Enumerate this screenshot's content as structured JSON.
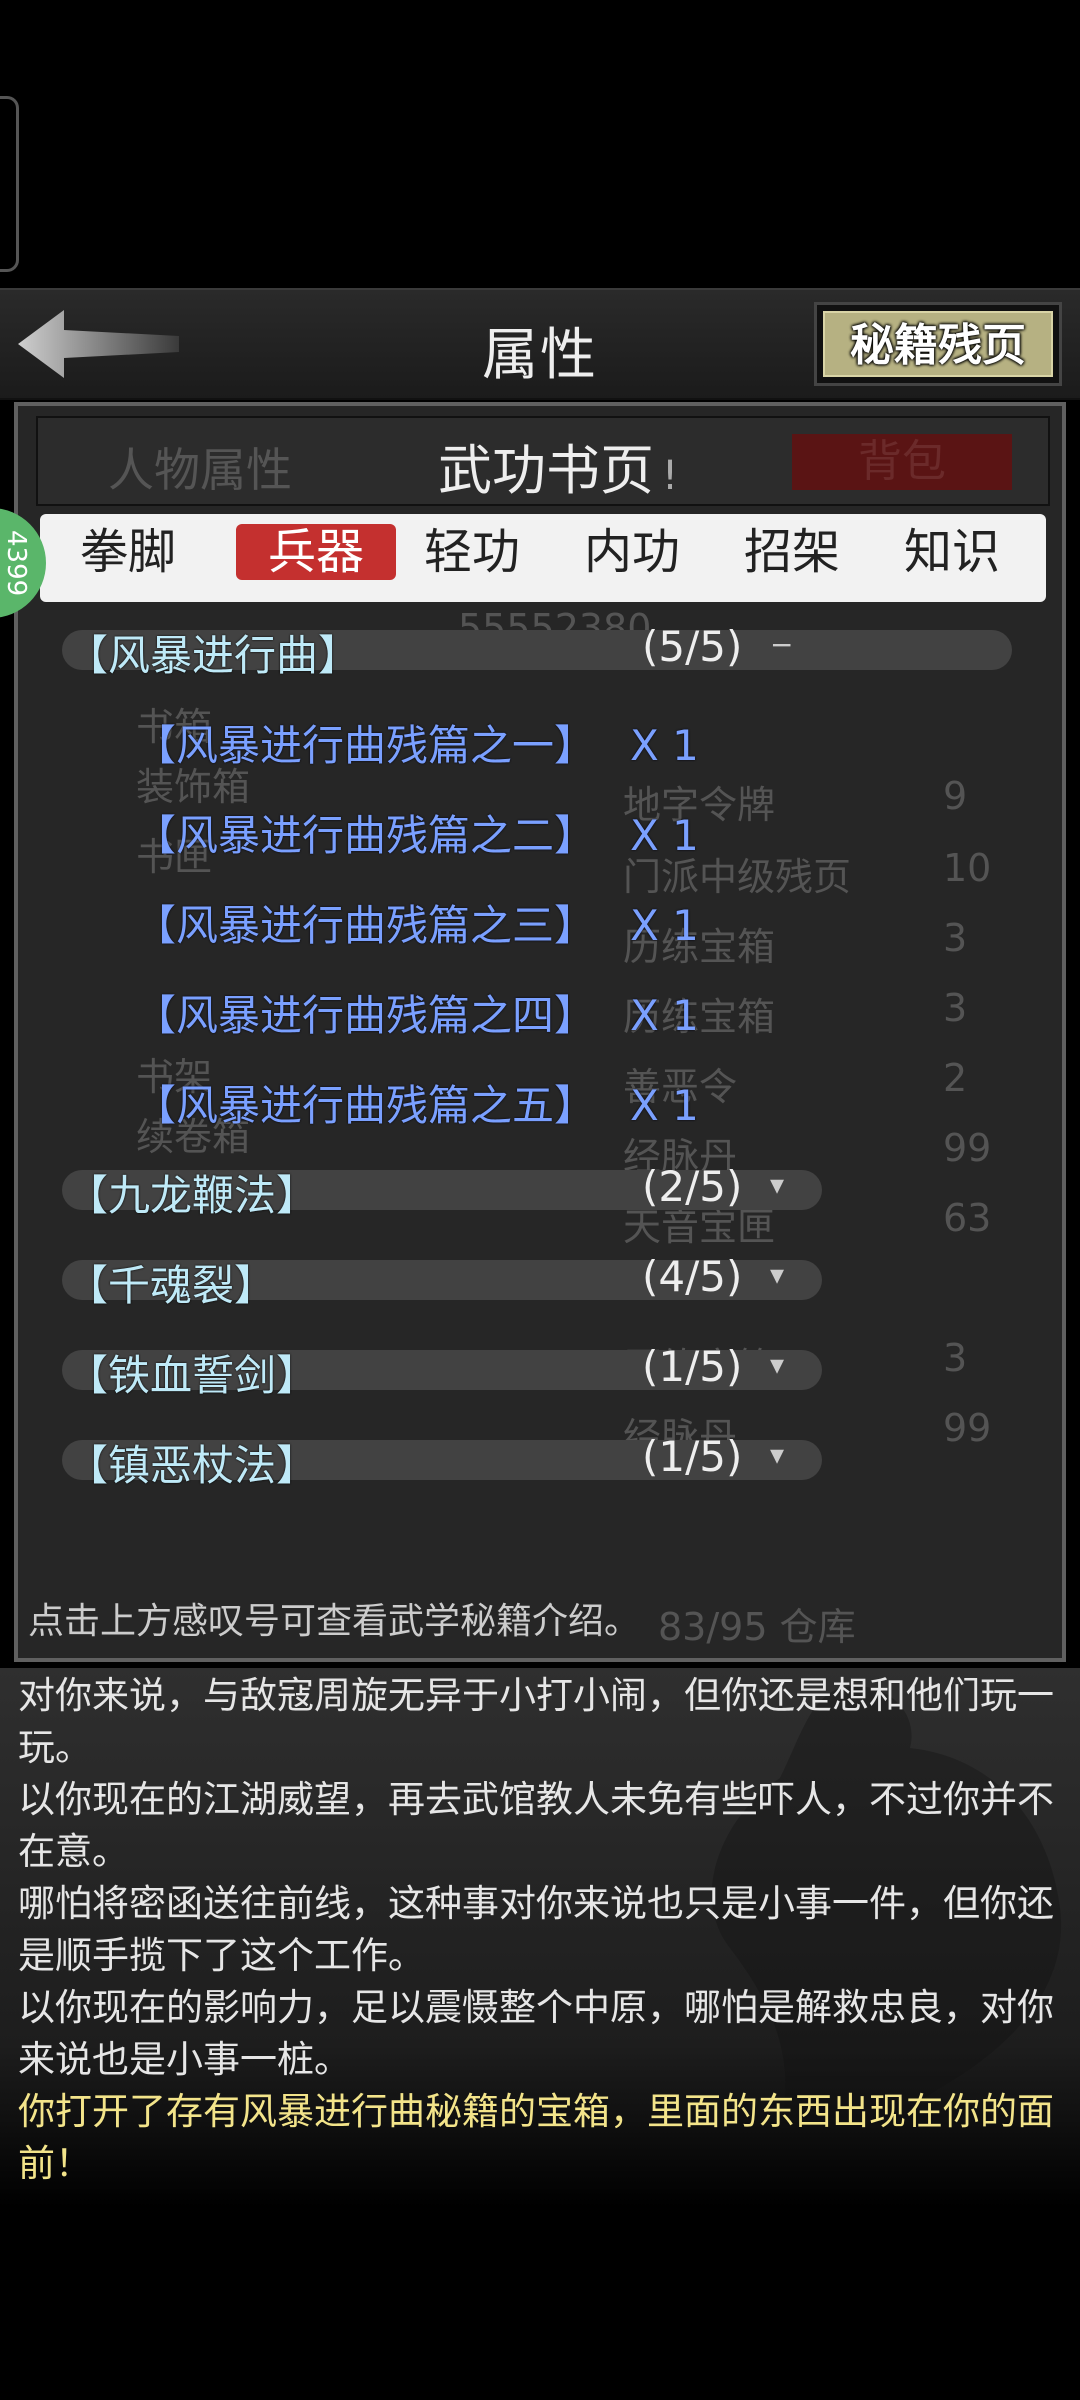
{
  "header": {
    "title": "属性",
    "right_button": "秘籍残页"
  },
  "panel": {
    "sub_title": "武功书页",
    "info_mark": "!",
    "bg_left_tab": "人物属性",
    "bg_right_tab": "背包",
    "side_badge": "4399"
  },
  "categories": [
    {
      "label": "拳脚",
      "active": false
    },
    {
      "label": "兵器",
      "active": true
    },
    {
      "label": "轻功",
      "active": false
    },
    {
      "label": "内功",
      "active": false
    },
    {
      "label": "招架",
      "active": false
    },
    {
      "label": "知识",
      "active": false
    }
  ],
  "books": [
    {
      "name": "【风暴进行曲】",
      "count": "(5/5)",
      "toggle": "−",
      "expanded": true
    },
    {
      "name": "【九龙鞭法】",
      "count": "(2/5)",
      "toggle": "▾",
      "expanded": false
    },
    {
      "name": "【千魂裂】",
      "count": "(4/5)",
      "toggle": "▾",
      "expanded": false
    },
    {
      "name": "【铁血誓剑】",
      "count": "(1/5)",
      "toggle": "▾",
      "expanded": false
    },
    {
      "name": "【镇恶杖法】",
      "count": "(1/5)",
      "toggle": "▾",
      "expanded": false
    }
  ],
  "chapters": [
    {
      "name": "【风暴进行曲残篇之一】",
      "qty": "X 1"
    },
    {
      "name": "【风暴进行曲残篇之二】",
      "qty": "X 1"
    },
    {
      "name": "【风暴进行曲残篇之三】",
      "qty": "X 1"
    },
    {
      "name": "【风暴进行曲残篇之四】",
      "qty": "X 1"
    },
    {
      "name": "【风暴进行曲残篇之五】",
      "qty": "X 1"
    }
  ],
  "background_items": {
    "left": [
      "书箱",
      "装饰箱",
      "书匣",
      "书架",
      "续卷箱"
    ],
    "right_names": [
      "地字令牌",
      "门派中级残页",
      "历练宝箱",
      "历练宝箱",
      "善恶令",
      "经脉丹",
      "天音宝匣",
      "历练宝箱",
      "经脉丹"
    ],
    "right_qty": [
      "9",
      "10",
      "3",
      "3",
      "2",
      "99",
      "63",
      "3",
      "99"
    ],
    "storage": "83/95 仓库",
    "gold": "55552380"
  },
  "hint": "点击上方感叹号可查看武学秘籍介绍。",
  "log": [
    {
      "text": "对你来说，与敌寇周旋无异于小打小闹，但你还是想和他们玩一玩。",
      "highlight": false
    },
    {
      "text": "以你现在的江湖威望，再去武馆教人未免有些吓人，不过你并不在意。",
      "highlight": false
    },
    {
      "text": "哪怕将密函送往前线，这种事对你来说也只是小事一件，但你还是顺手揽下了这个工作。",
      "highlight": false
    },
    {
      "text": "以你现在的影响力，足以震慑整个中原，哪怕是解救忠良，对你来说也是小事一桩。",
      "highlight": false
    },
    {
      "text": "你打开了存有风暴进行曲秘籍的宝箱，里面的东西出现在你的面前！",
      "highlight": true
    }
  ]
}
